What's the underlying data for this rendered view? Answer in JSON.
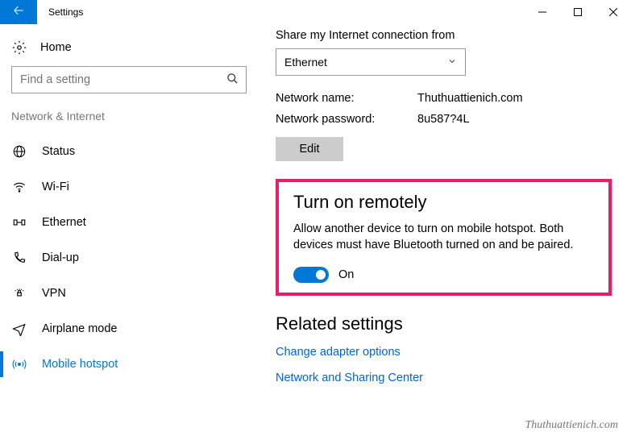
{
  "titlebar": {
    "title": "Settings"
  },
  "sidebar": {
    "home_label": "Home",
    "search_placeholder": "Find a setting",
    "category": "Network & Internet",
    "items": [
      {
        "label": "Status"
      },
      {
        "label": "Wi-Fi"
      },
      {
        "label": "Ethernet"
      },
      {
        "label": "Dial-up"
      },
      {
        "label": "VPN"
      },
      {
        "label": "Airplane mode"
      },
      {
        "label": "Mobile hotspot"
      }
    ]
  },
  "main": {
    "share_label": "Share my Internet connection from",
    "adapter_selected": "Ethernet",
    "network_name_label": "Network name:",
    "network_name_value": "Thuthuattienich.com",
    "network_password_label": "Network password:",
    "network_password_value": "8u587?4L",
    "edit_label": "Edit",
    "remote": {
      "heading": "Turn on remotely",
      "description": "Allow another device to turn on mobile hotspot. Both devices must have Bluetooth turned on and be paired.",
      "state_label": "On"
    },
    "related": {
      "heading": "Related settings",
      "links": [
        "Change adapter options",
        "Network and Sharing Center"
      ]
    }
  },
  "watermark": "Thuthuattienich.com"
}
